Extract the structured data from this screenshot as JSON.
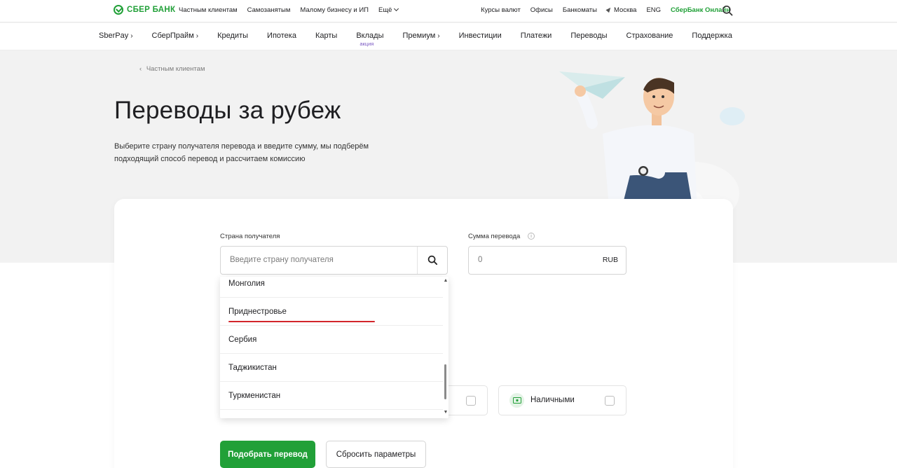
{
  "header": {
    "logo_text": "СБЕР БАНК",
    "nav": [
      "Частным клиентам",
      "Самозанятым",
      "Малому бизнесу и ИП",
      "Ещё"
    ],
    "right": {
      "rates": "Курсы валют",
      "offices": "Офисы",
      "atms": "Банкоматы",
      "city": "Москва",
      "lang": "ENG",
      "online": "СберБанк Онлайн"
    }
  },
  "mainnav": {
    "items": [
      {
        "label": "SberPay",
        "arrow": "›"
      },
      {
        "label": "СберПрайм",
        "arrow": "›"
      },
      {
        "label": "Кредиты"
      },
      {
        "label": "Ипотека"
      },
      {
        "label": "Карты"
      },
      {
        "label": "Вклады",
        "badge": "акция"
      },
      {
        "label": "Премиум",
        "arrow": "›"
      },
      {
        "label": "Инвестиции"
      },
      {
        "label": "Платежи"
      },
      {
        "label": "Переводы"
      },
      {
        "label": "Страхование"
      },
      {
        "label": "Поддержка"
      }
    ]
  },
  "hero": {
    "breadcrumb": "Частным клиентам",
    "title": "Переводы за рубеж",
    "subtitle": "Выберите страну получателя перевода и введите сумму, мы подберём подходящий способ перевод и рассчитаем комиссию"
  },
  "form": {
    "country_label": "Страна получателя",
    "country_placeholder": "Введите страну получателя",
    "amount_label": "Сумма перевода",
    "amount_value": "0",
    "currency": "RUB",
    "dropdown_options": [
      "Монголия",
      "Приднестровье",
      "Сербия",
      "Таджикистан",
      "Туркменистан"
    ],
    "cash_option": "Наличными",
    "submit_label": "Подобрать перевод",
    "reset_label": "Сбросить параметры"
  },
  "colors": {
    "brand_green": "#21a038",
    "highlight_red": "#d3262b"
  }
}
